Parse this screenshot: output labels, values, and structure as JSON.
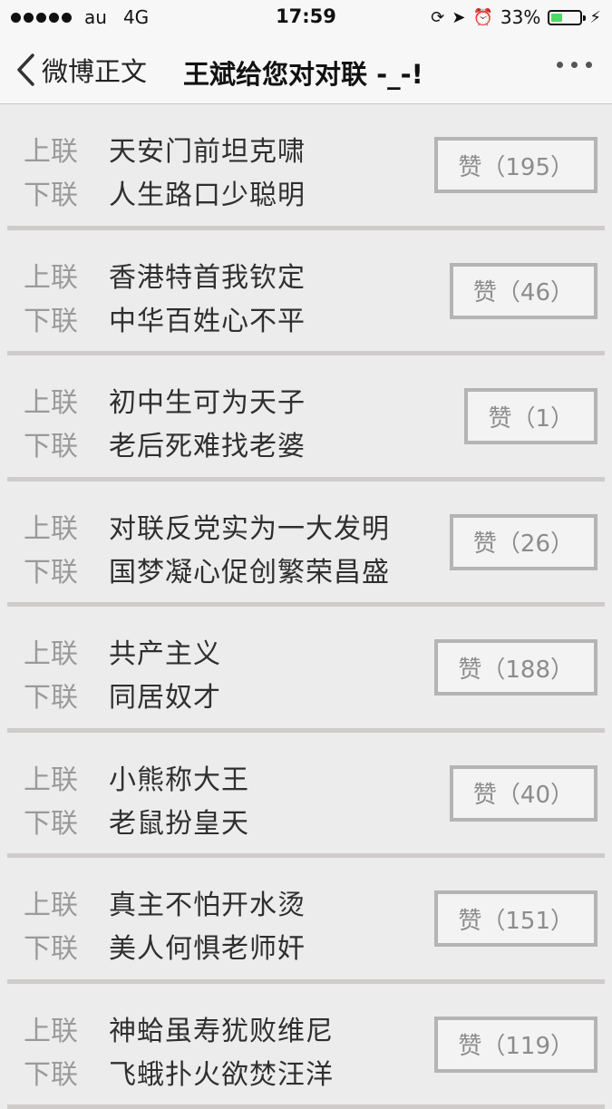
{
  "status": {
    "carrier": "au",
    "network": "4G",
    "time": "17:59",
    "battery": "33%",
    "battery_color": "#4cd964"
  },
  "nav": {
    "back_label": "微博正文",
    "title": "王斌给您对对联 -_-!"
  },
  "labels": {
    "upper": "上联",
    "lower": "下联"
  },
  "couplets": [
    {
      "upper": "天安门前坦克啸",
      "lower": "人生路口少聪明",
      "likes": "赞（195）"
    },
    {
      "upper": "香港特首我钦定",
      "lower": "中华百姓心不平",
      "likes": "赞（46）"
    },
    {
      "upper": "初中生可为天子",
      "lower": "老后死难找老婆",
      "likes": "赞（1）"
    },
    {
      "upper": "对联反党实为一大发明",
      "lower": "国梦凝心促创繁荣昌盛",
      "likes": "赞（26）"
    },
    {
      "upper": "共产主义",
      "lower": "同居奴才",
      "likes": "赞（188）"
    },
    {
      "upper": "小熊称大王",
      "lower": "老鼠扮皇天",
      "likes": "赞（40）"
    },
    {
      "upper": "真主不怕开水烫",
      "lower": "美人何惧老师奸",
      "likes": "赞（151）"
    },
    {
      "upper": "神蛤虽寿犹败维尼",
      "lower": "飞蛾扑火欲焚汪洋",
      "likes": "赞（119）"
    }
  ]
}
